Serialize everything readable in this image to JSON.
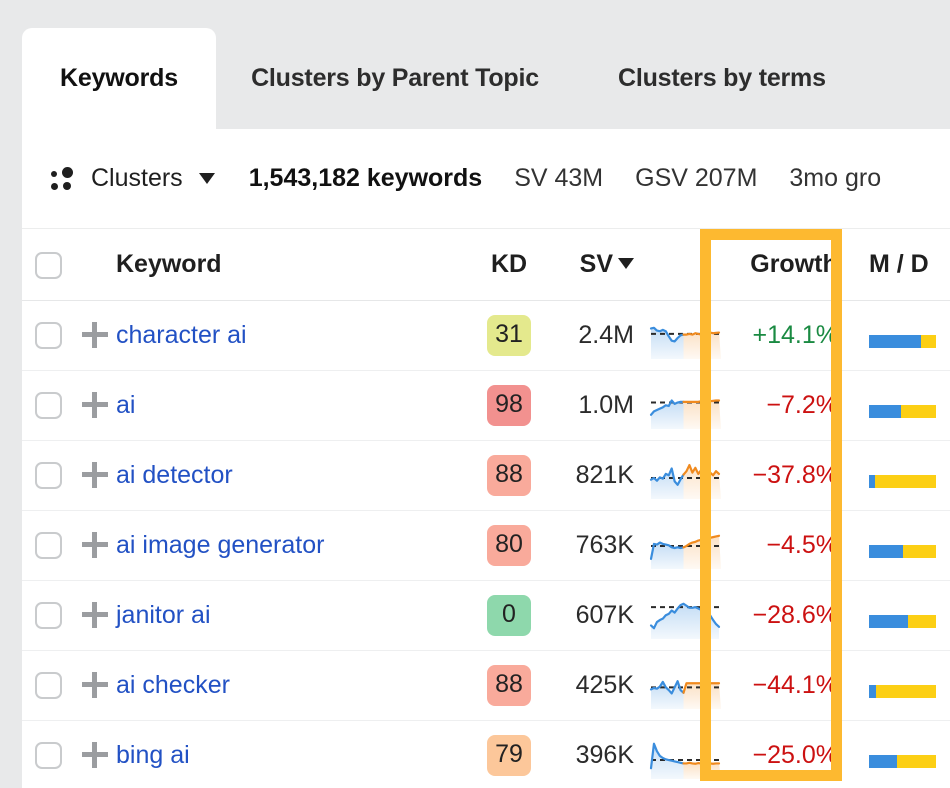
{
  "tabs": [
    {
      "label": "Keywords",
      "active": true
    },
    {
      "label": "Clusters by Parent Topic",
      "active": false
    },
    {
      "label": "Clusters by terms",
      "active": false
    }
  ],
  "toolbar": {
    "clusters_label": "Clusters",
    "keyword_count": "1,543,182 keywords",
    "metrics": [
      {
        "label": "SV 43M"
      },
      {
        "label": "GSV 207M"
      },
      {
        "label": "3mo gro"
      }
    ]
  },
  "table": {
    "headers": {
      "keyword": "Keyword",
      "kd": "KD",
      "sv": "SV",
      "growth": "Growth",
      "md": "M / D"
    },
    "sort_column": "SV",
    "rows": [
      {
        "keyword": "character ai",
        "kd": "31",
        "kd_color": "#e4e98d",
        "sv": "2.4M",
        "growth": "+14.1%",
        "growth_dir": "up",
        "md_blue_pct": 77
      },
      {
        "keyword": "ai",
        "kd": "98",
        "kd_color": "#f2918f",
        "sv": "1.0M",
        "growth": "−7.2%",
        "growth_dir": "down",
        "md_blue_pct": 48
      },
      {
        "keyword": "ai detector",
        "kd": "88",
        "kd_color": "#f9aa9b",
        "sv": "821K",
        "growth": "−37.8%",
        "growth_dir": "down",
        "md_blue_pct": 9
      },
      {
        "keyword": "ai image generator",
        "kd": "80",
        "kd_color": "#f9aa9b",
        "sv": "763K",
        "growth": "−4.5%",
        "growth_dir": "down",
        "md_blue_pct": 50
      },
      {
        "keyword": "janitor ai",
        "kd": "0",
        "kd_color": "#8ed8ac",
        "sv": "607K",
        "growth": "−28.6%",
        "growth_dir": "down",
        "md_blue_pct": 58
      },
      {
        "keyword": "ai checker",
        "kd": "88",
        "kd_color": "#f9aa9b",
        "sv": "425K",
        "growth": "−44.1%",
        "growth_dir": "down",
        "md_blue_pct": 10
      },
      {
        "keyword": "bing ai",
        "kd": "79",
        "kd_color": "#fcc79a",
        "sv": "396K",
        "growth": "−25.0%",
        "growth_dir": "down",
        "md_blue_pct": 42
      }
    ]
  },
  "colors": {
    "accent_highlight": "#fdb930",
    "link": "#2251c4",
    "growth_up": "#1a8a42",
    "growth_down": "#cc1111",
    "bar_blue": "#3a8ddd",
    "bar_yellow": "#fccf14",
    "spark_past": "#3a8ddd",
    "spark_forecast": "#f08a1e"
  },
  "chart_data": [
    {
      "type": "line",
      "title": "character ai volume trend",
      "split_index": 11,
      "past": [
        0.78,
        0.8,
        0.72,
        0.7,
        0.74,
        0.7,
        0.55,
        0.42,
        0.4,
        0.5,
        0.58,
        0.6
      ],
      "forecast": [
        0.6,
        0.62,
        0.6,
        0.64,
        0.62,
        0.6,
        0.62,
        0.7,
        0.66,
        0.64,
        0.65,
        0.66
      ],
      "reference_line": 0.62
    },
    {
      "type": "line",
      "title": "ai volume trend",
      "split_index": 11,
      "past": [
        0.3,
        0.4,
        0.44,
        0.48,
        0.52,
        0.58,
        0.56,
        0.72,
        0.62,
        0.66,
        0.68,
        0.68
      ],
      "forecast": [
        0.68,
        0.68,
        0.68,
        0.68,
        0.68,
        0.7,
        0.74,
        0.7,
        0.7,
        0.71,
        0.72,
        0.72
      ],
      "reference_line": 0.66
    },
    {
      "type": "line",
      "title": "ai detector volume trend",
      "split_index": 11,
      "past": [
        0.45,
        0.5,
        0.42,
        0.52,
        0.48,
        0.62,
        0.58,
        0.78,
        0.4,
        0.3,
        0.46,
        0.6
      ],
      "forecast": [
        0.7,
        0.88,
        0.66,
        0.8,
        0.62,
        0.74,
        0.96,
        0.72,
        0.66,
        0.58,
        0.7,
        0.62
      ],
      "reference_line": 0.5
    },
    {
      "type": "line",
      "title": "ai image generator volume trend",
      "split_index": 11,
      "past": [
        0.18,
        0.62,
        0.6,
        0.66,
        0.62,
        0.6,
        0.58,
        0.52,
        0.5,
        0.52,
        0.5,
        0.52
      ],
      "forecast": [
        0.56,
        0.62,
        0.66,
        0.68,
        0.72,
        0.74,
        0.76,
        0.78,
        0.8,
        0.82,
        0.84,
        0.86
      ],
      "reference_line": 0.56
    },
    {
      "type": "line",
      "title": "janitor ai volume trend",
      "split_index": 23,
      "past": [
        0.28,
        0.2,
        0.38,
        0.44,
        0.48,
        0.58,
        0.62,
        0.72,
        0.66,
        0.78,
        0.88,
        0.92,
        0.86,
        0.8,
        0.8,
        0.82,
        0.78,
        0.74,
        0.7,
        0.66,
        0.58,
        0.44,
        0.32,
        0.24
      ],
      "forecast": [],
      "reference_line": 0.82
    },
    {
      "type": "line",
      "title": "ai checker volume trend",
      "split_index": 11,
      "past": [
        0.46,
        0.5,
        0.48,
        0.54,
        0.68,
        0.52,
        0.44,
        0.34,
        0.52,
        0.7,
        0.44,
        0.36
      ],
      "forecast": [
        0.64,
        0.64,
        0.64,
        0.64,
        0.64,
        0.64,
        0.64,
        0.64,
        0.64,
        0.64,
        0.64,
        0.64
      ],
      "reference_line": 0.52
    },
    {
      "type": "line",
      "title": "bing ai volume trend",
      "split_index": 11,
      "past": [
        0.2,
        0.92,
        0.7,
        0.56,
        0.5,
        0.46,
        0.44,
        0.42,
        0.4,
        0.38,
        0.36,
        0.34
      ],
      "forecast": [
        0.34,
        0.36,
        0.34,
        0.33,
        0.35,
        0.34,
        0.33,
        0.34,
        0.34,
        0.33,
        0.34,
        0.34
      ],
      "reference_line": 0.44
    }
  ]
}
